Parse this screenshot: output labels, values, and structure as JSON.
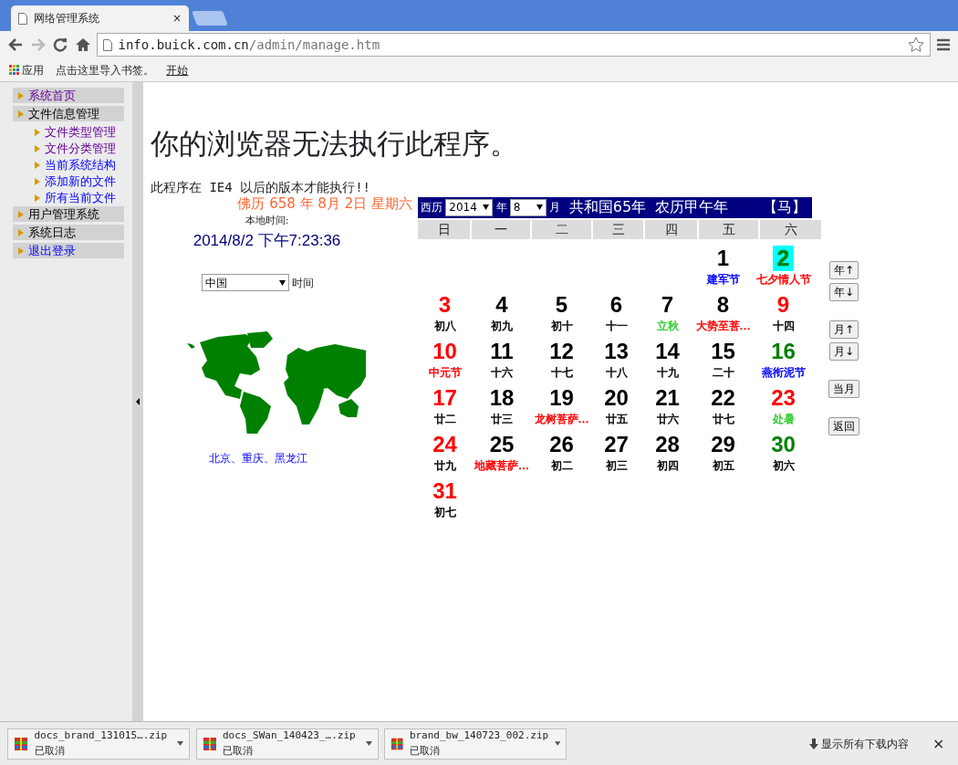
{
  "browser": {
    "tab_title": "网络管理系统",
    "tab_close": "×",
    "address_host": "info.buick.com.cn",
    "address_path": "/admin/manage.htm",
    "bookmarks": [
      "应用",
      "点击这里导入书签。",
      "开始"
    ]
  },
  "sidebar": {
    "items": [
      {
        "label": "系统首页",
        "kind": "link",
        "visited": true
      },
      {
        "label": "文件信息管理",
        "kind": "heading",
        "children": [
          {
            "label": "文件类型管理",
            "kind": "link",
            "visited": true
          },
          {
            "label": "文件分类管理",
            "kind": "link",
            "visited": true
          },
          {
            "label": "当前系统结构",
            "kind": "link",
            "visited": false
          },
          {
            "label": "添加新的文件",
            "kind": "link",
            "visited": false
          },
          {
            "label": "所有当前文件",
            "kind": "link",
            "visited": false
          }
        ]
      },
      {
        "label": "用户管理系统",
        "kind": "heading"
      },
      {
        "label": "系统日志",
        "kind": "heading"
      },
      {
        "label": "退出登录",
        "kind": "link",
        "visited": false
      }
    ]
  },
  "main": {
    "title": "你的浏览器无法执行此程序。",
    "notice": "此程序在 IE4 以后的版本才能执行!!"
  },
  "clock": {
    "buddhist_date": "佛历 658 年 8月 2日 星期六",
    "local_label": "本地时间:",
    "local_time": "2014/8/2 下午7:23:36",
    "region": "中国",
    "region_suffix": "时间",
    "cities": "北京、重庆、黑龙江"
  },
  "calendar": {
    "era_label": "西历",
    "year": "2014",
    "year_suffix": "年",
    "month": "8",
    "month_suffix": "月",
    "republic_year": "共和国65年",
    "lunar_year": "农历甲午年",
    "zodiac": "【马】",
    "weekdays": [
      "日",
      "一",
      "二",
      "三",
      "四",
      "五",
      "六"
    ],
    "weeks": [
      [
        {
          "day": "1",
          "kind": "workday",
          "selected": false,
          "lunar": {
            "text": "建军节",
            "color": "#0000ff"
          }
        },
        {
          "day": "2",
          "kind": "saturday",
          "selected": true,
          "lunar": {
            "text": "七夕情人节",
            "color": "#ff0000"
          }
        }
      ],
      [
        {
          "day": "3",
          "kind": "holiday",
          "selected": false,
          "lunar": {
            "text": "初八"
          }
        },
        {
          "day": "4",
          "kind": "workday",
          "selected": false,
          "lunar": {
            "text": "初九"
          }
        },
        {
          "day": "5",
          "kind": "workday",
          "selected": false,
          "lunar": {
            "text": "初十"
          }
        },
        {
          "day": "6",
          "kind": "workday",
          "selected": false,
          "lunar": {
            "text": "十一"
          }
        },
        {
          "day": "7",
          "kind": "workday",
          "selected": false,
          "lunar": {
            "text": "立秋",
            "color": "#33cc33"
          }
        },
        {
          "day": "8",
          "kind": "workday",
          "selected": false,
          "lunar": {
            "text": "大势至菩…",
            "color": "#ff0000"
          }
        },
        {
          "day": "9",
          "kind": "holiday",
          "selected": false,
          "lunar": {
            "text": "十四"
          }
        }
      ],
      [
        {
          "day": "10",
          "kind": "holiday",
          "selected": false,
          "lunar": {
            "text": "中元节",
            "color": "#ff0000"
          }
        },
        {
          "day": "11",
          "kind": "workday",
          "selected": false,
          "lunar": {
            "text": "十六"
          }
        },
        {
          "day": "12",
          "kind": "workday",
          "selected": false,
          "lunar": {
            "text": "十七"
          }
        },
        {
          "day": "13",
          "kind": "workday",
          "selected": false,
          "lunar": {
            "text": "十八"
          }
        },
        {
          "day": "14",
          "kind": "workday",
          "selected": false,
          "lunar": {
            "text": "十九"
          }
        },
        {
          "day": "15",
          "kind": "workday",
          "selected": false,
          "lunar": {
            "text": "二十"
          }
        },
        {
          "day": "16",
          "kind": "saturday",
          "selected": false,
          "lunar": {
            "text": "燕衔泥节",
            "color": "#0000ff"
          }
        }
      ],
      [
        {
          "day": "17",
          "kind": "holiday",
          "selected": false,
          "lunar": {
            "text": "廿二"
          }
        },
        {
          "day": "18",
          "kind": "workday",
          "selected": false,
          "lunar": {
            "text": "廿三"
          }
        },
        {
          "day": "19",
          "kind": "workday",
          "selected": false,
          "lunar": {
            "text": "龙树菩萨…",
            "color": "#ff0000"
          }
        },
        {
          "day": "20",
          "kind": "workday",
          "selected": false,
          "lunar": {
            "text": "廿五"
          }
        },
        {
          "day": "21",
          "kind": "workday",
          "selected": false,
          "lunar": {
            "text": "廿六"
          }
        },
        {
          "day": "22",
          "kind": "workday",
          "selected": false,
          "lunar": {
            "text": "廿七"
          }
        },
        {
          "day": "23",
          "kind": "holiday",
          "selected": false,
          "lunar": {
            "text": "处暑",
            "color": "#33cc33"
          }
        }
      ],
      [
        {
          "day": "24",
          "kind": "holiday",
          "selected": false,
          "lunar": {
            "text": "廿九"
          }
        },
        {
          "day": "25",
          "kind": "workday",
          "selected": false,
          "lunar": {
            "text": "地藏菩萨…",
            "color": "#ff0000"
          }
        },
        {
          "day": "26",
          "kind": "workday",
          "selected": false,
          "lunar": {
            "text": "初二"
          }
        },
        {
          "day": "27",
          "kind": "workday",
          "selected": false,
          "lunar": {
            "text": "初三"
          }
        },
        {
          "day": "28",
          "kind": "workday",
          "selected": false,
          "lunar": {
            "text": "初四"
          }
        },
        {
          "day": "29",
          "kind": "workday",
          "selected": false,
          "lunar": {
            "text": "初五"
          }
        },
        {
          "day": "30",
          "kind": "saturday",
          "selected": false,
          "lunar": {
            "text": "初六"
          }
        }
      ],
      [
        {
          "day": "31",
          "kind": "holiday",
          "selected": false,
          "lunar": {
            "text": "初七"
          }
        }
      ]
    ],
    "nav_button_groups": [
      [
        "年↑",
        "年↓"
      ],
      [
        "月↑",
        "月↓"
      ],
      [
        "当月"
      ],
      [
        "返回"
      ]
    ]
  },
  "downloads": {
    "items": [
      {
        "file": "docs_brand_131015….zip",
        "status": "已取消"
      },
      {
        "file": "docs_SWan_140423_….zip",
        "status": "已取消"
      },
      {
        "file": "brand_bw_140723_002.zip",
        "status": "已取消"
      }
    ],
    "show_all": "显示所有下载内容",
    "close": "×"
  }
}
